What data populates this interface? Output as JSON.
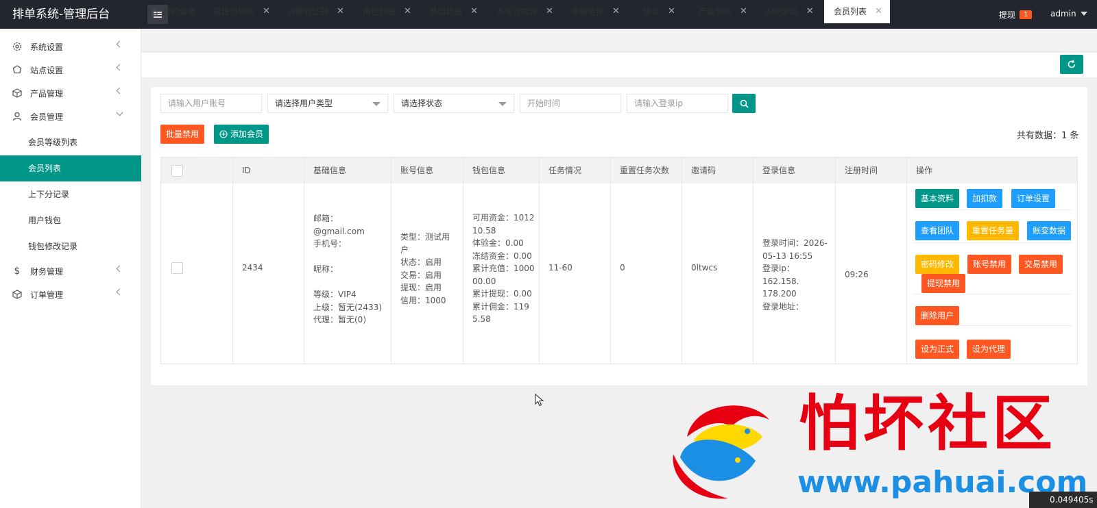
{
  "header": {
    "brand": "排单系统-管理后台",
    "withdraw_label": "提现",
    "withdraw_count": "1",
    "user": "admin"
  },
  "sidebar": {
    "items": [
      {
        "label": "系统设置",
        "icon": "gear-icon"
      },
      {
        "label": "站点设置",
        "icon": "site-icon"
      },
      {
        "label": "产品管理",
        "icon": "box-icon"
      },
      {
        "label": "会员管理",
        "icon": "user-icon"
      },
      {
        "label": "财务管理",
        "icon": "dollar-icon"
      },
      {
        "label": "订单管理",
        "icon": "box-icon"
      }
    ],
    "sub_items": [
      "会员等级列表",
      "会员列表",
      "上下分记录",
      "用户钱包",
      "钱包修改记录"
    ]
  },
  "tabs": [
    "我的桌面",
    "管理员列表",
    "谷歌验证器",
    "角色列表",
    "基础数据",
    "多语言内容",
    "客服链接",
    "协议",
    "产品列表",
    "APP滚动",
    "会员列表"
  ],
  "filters": {
    "account_placeholder": "请输入用户账号",
    "user_type": "请选择用户类型",
    "status": "请选择状态",
    "start_time_placeholder": "开始时间",
    "login_ip_placeholder": "请输入登录ip"
  },
  "actions": {
    "batch_disable": "批量禁用",
    "add_member": "添加会员",
    "total": "共有数据：1 条"
  },
  "table": {
    "headers": [
      "ID",
      "基础信息",
      "账号信息",
      "钱包信息",
      "任务情况",
      "重置任务次数",
      "邀请码",
      "登录信息",
      "注册时间",
      "操作"
    ],
    "row": {
      "id": "2434",
      "basic": [
        "邮箱：",
        "@gmail.com",
        "手机号：",
        "",
        "昵称：",
        "",
        "等级：VIP4",
        "上级：暂无(2433)",
        "代理：暂无(0)"
      ],
      "account": [
        "类型：测试用",
        "户",
        "状态：启用",
        "交易：启用",
        "提现：启用",
        "信用：1000"
      ],
      "wallet": [
        "可用资金：1012",
        "10.58",
        "体验金：0.00",
        "冻结资金：0.00",
        "累计充值：1000",
        "00.00",
        "累计提现：0.00",
        "累计佣金：119",
        "5.58"
      ],
      "task": "11-60",
      "reset_count": "0",
      "invite_code": "0ltwcs",
      "login": [
        "登录时间：2026-",
        "05-13 16:55",
        "登录ip： 162.158.",
        "178.200",
        "登录地址："
      ],
      "register_time": "09:26",
      "ops": [
        "基本资料",
        "加扣款",
        "订单设置",
        "查看团队",
        "重置任务量",
        "账变数据",
        "密码修改",
        "账号禁用",
        "交易禁用",
        "提现禁用",
        "删除用户",
        "设为正式",
        "设为代理"
      ]
    }
  },
  "watermark": {
    "text": "怕坏社区",
    "url": "www.pahuai.com"
  },
  "timer": "0.049405s"
}
